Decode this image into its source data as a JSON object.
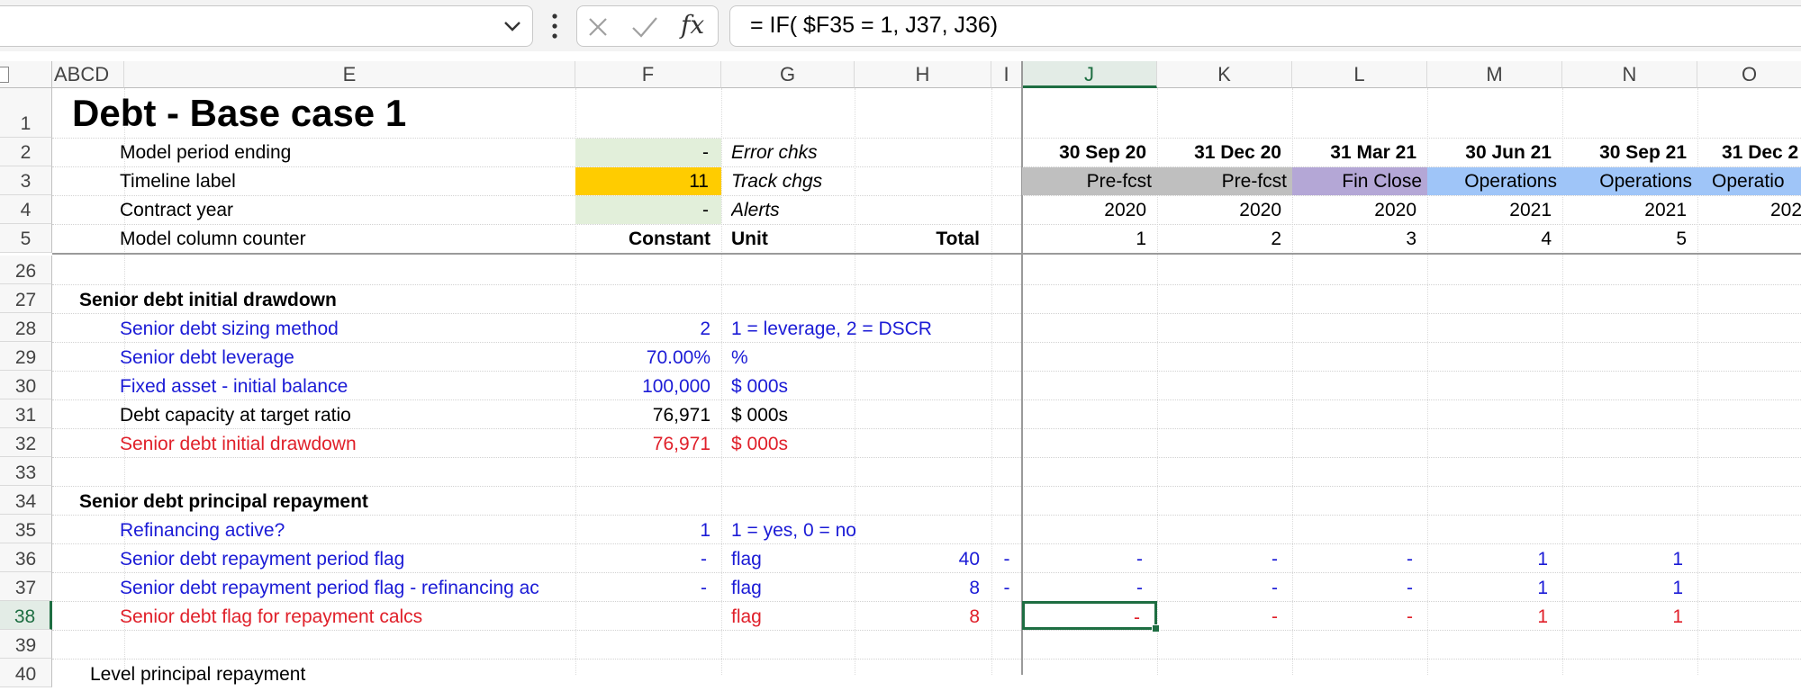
{
  "formula_bar": {
    "formula": "= IF( $F35 = 1, J37, J36)",
    "cancel_icon": "x-icon",
    "enter_icon": "check-icon",
    "fx_label": "fx"
  },
  "columns": [
    "ABCD",
    "E",
    "F",
    "G",
    "H",
    "I",
    "J",
    "K",
    "L",
    "M",
    "N",
    "O"
  ],
  "rows": [
    "1",
    "2",
    "3",
    "4",
    "5",
    "26",
    "27",
    "28",
    "29",
    "30",
    "31",
    "32",
    "33",
    "34",
    "35",
    "36",
    "37",
    "38",
    "39",
    "40"
  ],
  "sheet": {
    "title": "Debt - Base case 1",
    "header_rows": [
      {
        "label": "Model period ending",
        "f": "-",
        "g": "Error chks"
      },
      {
        "label": "Timeline label",
        "f": "11",
        "g": "Track chgs"
      },
      {
        "label": "Contract year",
        "f": "-",
        "g": "Alerts"
      },
      {
        "label": "Model column counter",
        "f": "Constant",
        "g": "Unit",
        "h": "Total"
      }
    ],
    "timeline": {
      "dates": [
        "30 Sep 20",
        "31 Dec 20",
        "31 Mar 21",
        "30 Jun 21",
        "30 Sep 21",
        "31 Dec 2"
      ],
      "labels": [
        "Pre-fcst",
        "Pre-fcst",
        "Fin Close",
        "Operations",
        "Operations",
        "Operatio"
      ],
      "years": [
        "2020",
        "2020",
        "2020",
        "2021",
        "2021",
        "202"
      ],
      "counters": [
        "1",
        "2",
        "3",
        "4",
        "5"
      ]
    },
    "section1": {
      "heading": "Senior debt initial drawdown",
      "rows": [
        {
          "label": "Senior debt sizing method",
          "f": "2",
          "g": "1 = leverage, 2 = DSCR"
        },
        {
          "label": "Senior debt leverage",
          "f": "70.00%",
          "g": "%"
        },
        {
          "label": "Fixed asset - initial balance",
          "f": "100,000",
          "g": "$ 000s"
        },
        {
          "label": "Debt capacity at target ratio",
          "f": "76,971",
          "g": "$ 000s"
        },
        {
          "label": "Senior debt initial drawdown",
          "f": "76,971",
          "g": "$ 000s"
        }
      ]
    },
    "section2": {
      "heading": "Senior debt principal repayment",
      "rows": [
        {
          "label": "Refinancing active?",
          "f": "1",
          "g": "1 = yes, 0 = no"
        },
        {
          "label": "Senior debt repayment period flag",
          "f": "-",
          "g": "flag",
          "h": "40",
          "i": "-",
          "vals": [
            "-",
            "-",
            "-",
            "1",
            "1"
          ]
        },
        {
          "label": "Senior debt repayment period flag - refinancing ac",
          "f": "-",
          "g": "flag",
          "h": "8",
          "i": "-",
          "vals": [
            "-",
            "-",
            "-",
            "1",
            "1"
          ]
        },
        {
          "label": "Senior debt flag for repayment calcs",
          "g": "flag",
          "h": "8",
          "vals": [
            "-",
            "-",
            "-",
            "1",
            "1"
          ]
        }
      ]
    },
    "row40_label": "Level principal repayment"
  },
  "colors": {
    "input_fill": "#e2efda",
    "timeline_label_fill": "#ffcc00",
    "prefcst_fill": "#bfbfbf",
    "finclose_fill": "#b4a7d6",
    "operations_fill": "#9fc5f8",
    "input_text": "#1b1bd6",
    "calc_highlight": "#e0202a",
    "selection_green": "#1e6e42"
  }
}
